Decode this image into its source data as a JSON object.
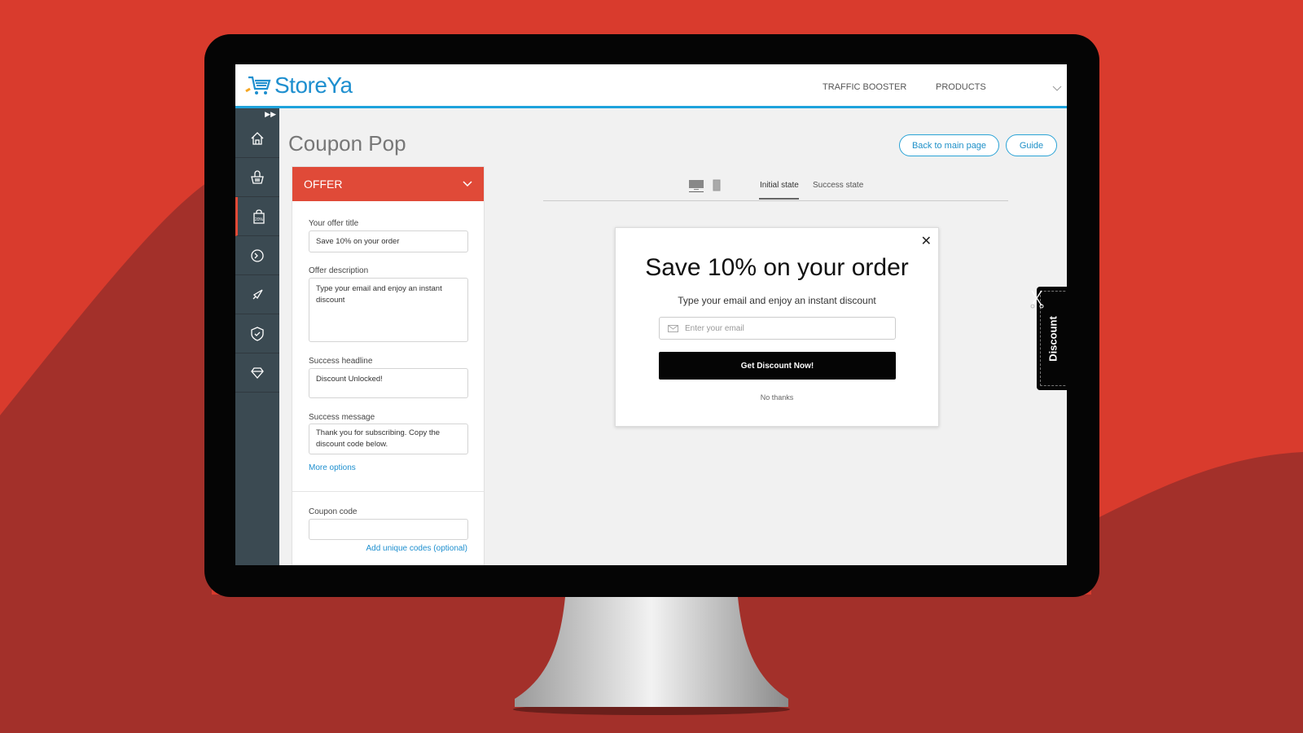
{
  "colors": {
    "background": "#d93b2d",
    "background_wave": "#a3302a",
    "accent_red": "#e04a38",
    "brand_blue": "#1e8fcf",
    "sidebar": "#3b4a52"
  },
  "header": {
    "logo": "StoreYa",
    "nav": [
      "TRAFFIC BOOSTER",
      "PRODUCTS"
    ]
  },
  "sidebar": {
    "items": [
      {
        "icon": "home-icon"
      },
      {
        "icon": "basket-icon"
      },
      {
        "icon": "shopping-bag-discount-icon",
        "active": true
      },
      {
        "icon": "timer-icon"
      },
      {
        "icon": "rocket-icon"
      },
      {
        "icon": "shield-check-icon"
      },
      {
        "icon": "diamond-icon"
      }
    ]
  },
  "page": {
    "title": "Coupon Pop",
    "back_button": "Back to main page",
    "guide_button": "Guide"
  },
  "offer": {
    "header": "OFFER",
    "title_label": "Your offer title",
    "title_value": "Save 10% on your order",
    "desc_label": "Offer description",
    "desc_value": "Type your email and enjoy an instant discount",
    "success_headline_label": "Success headline",
    "success_headline_value": "Discount Unlocked!",
    "success_message_label": "Success message",
    "success_message_value": "Thank you for subscribing. Copy the discount code below.",
    "more_options": "More options",
    "coupon_label": "Coupon code",
    "coupon_value": "",
    "unique_codes": "Add unique codes (optional)"
  },
  "preview": {
    "tabs": [
      "Initial state",
      "Success state"
    ],
    "active_tab": "Initial state",
    "heading": "Save 10% on your order",
    "description": "Type your email and enjoy an instant discount",
    "email_placeholder": "Enter your email",
    "cta": "Get Discount Now!",
    "dismiss": "No thanks",
    "side_tab": "Discount"
  }
}
